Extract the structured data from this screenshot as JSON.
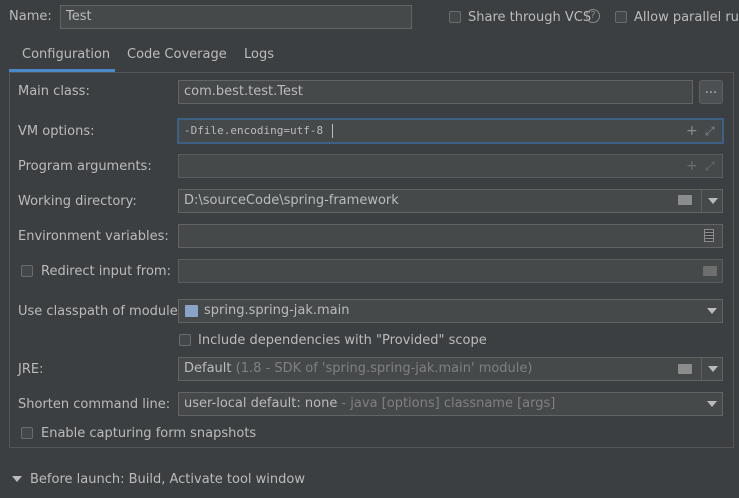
{
  "header": {
    "name_label": "Name:",
    "name_value": "Test",
    "share_label": "Share through VCS",
    "help_glyph": "?",
    "parallel_label": "Allow parallel run"
  },
  "tabs": [
    {
      "label": "Configuration",
      "active": true
    },
    {
      "label": "Code Coverage",
      "active": false
    },
    {
      "label": "Logs",
      "active": false
    }
  ],
  "form": {
    "main_class": {
      "label": "Main class:",
      "value": "com.best.test.Test",
      "button": "..."
    },
    "vm_options": {
      "label": "VM options:",
      "value": "-Dfile.encoding=utf-8"
    },
    "program_arguments": {
      "label": "Program arguments:",
      "value": ""
    },
    "working_directory": {
      "label": "Working directory:",
      "value": "D:\\sourceCode\\spring-framework"
    },
    "environment_variables": {
      "label": "Environment variables:",
      "value": ""
    },
    "redirect_input": {
      "label": "Redirect input from:",
      "checked": false,
      "value": ""
    },
    "classpath_module": {
      "label": "Use classpath of module:",
      "value": "spring.spring-jak.main"
    },
    "include_provided": {
      "label": "Include dependencies with \"Provided\" scope",
      "checked": false
    },
    "jre": {
      "label": "JRE:",
      "value": "Default",
      "hint": "(1.8 - SDK of 'spring.spring-jak.main' module)"
    },
    "shorten_command_line": {
      "label": "Shorten command line:",
      "value": "user-local default: none",
      "hint": "- java [options] classname [args]"
    },
    "capture_snapshots": {
      "label": "Enable capturing form snapshots",
      "checked": false
    }
  },
  "before_launch": {
    "label": "Before launch: Build, Activate tool window"
  },
  "colors": {
    "background": "#3c3f41",
    "field_background": "#45494a",
    "focus_border": "#3d6185",
    "active_tab_underline": "#4a88c7",
    "text": "#bbbbbb",
    "hint_text": "#808080"
  },
  "icons": [
    "help-icon",
    "ellipsis-icon",
    "expand-icon",
    "plus-icon",
    "folder-icon",
    "list-icon",
    "dropdown-arrow-icon",
    "module-icon",
    "expand-triangle-icon"
  ]
}
